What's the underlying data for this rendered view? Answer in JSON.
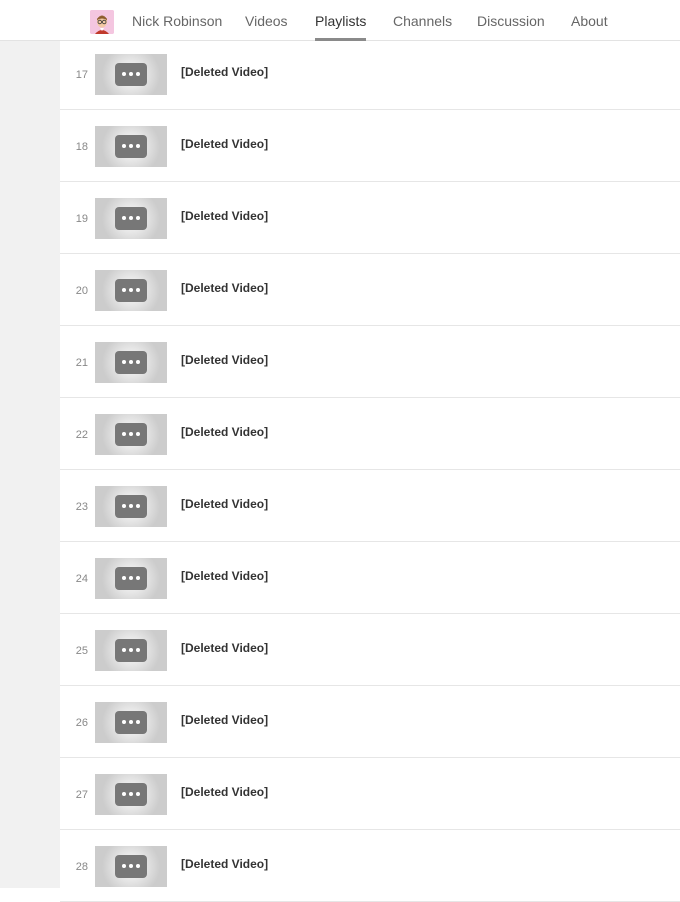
{
  "channel": {
    "name": "Nick Robinson",
    "avatar_icon": "nerd-avatar-icon"
  },
  "tabs": [
    {
      "label": "Videos",
      "active": false
    },
    {
      "label": "Playlists",
      "active": true
    },
    {
      "label": "Channels",
      "active": false
    },
    {
      "label": "Discussion",
      "active": false
    },
    {
      "label": "About",
      "active": false
    }
  ],
  "playlist": {
    "items": [
      {
        "index": "17",
        "title": "[Deleted Video]"
      },
      {
        "index": "18",
        "title": "[Deleted Video]"
      },
      {
        "index": "19",
        "title": "[Deleted Video]"
      },
      {
        "index": "20",
        "title": "[Deleted Video]"
      },
      {
        "index": "21",
        "title": "[Deleted Video]"
      },
      {
        "index": "22",
        "title": "[Deleted Video]"
      },
      {
        "index": "23",
        "title": "[Deleted Video]"
      },
      {
        "index": "24",
        "title": "[Deleted Video]"
      },
      {
        "index": "25",
        "title": "[Deleted Video]"
      },
      {
        "index": "26",
        "title": "[Deleted Video]"
      },
      {
        "index": "27",
        "title": "[Deleted Video]"
      },
      {
        "index": "28",
        "title": "[Deleted Video]"
      }
    ]
  },
  "colors": {
    "gutter": "#f1f1f1",
    "active_underline": "#8a8a8a",
    "thumb_button": "#777777"
  }
}
